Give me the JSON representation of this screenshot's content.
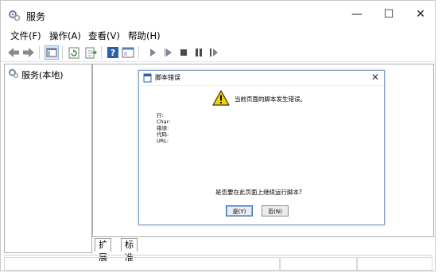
{
  "window": {
    "title": "服务",
    "minimize": "—",
    "maximize": "☐",
    "close": "✕"
  },
  "menu": [
    "文件(F)",
    "操作(A)",
    "查看(V)",
    "帮助(H)"
  ],
  "toolbar_icons": [
    "back-arrow",
    "forward-arrow",
    "console-tree",
    "refresh",
    "export-list",
    "help",
    "properties",
    "start",
    "start-alt",
    "stop",
    "pause",
    "restart"
  ],
  "tree": {
    "root": "服务(本地)"
  },
  "tabs": [
    "扩展",
    "标准"
  ],
  "dialog": {
    "title": "脚本错误",
    "close": "✕",
    "message": "当前页面的脚本发生错误。",
    "fields": [
      "行:",
      "Char:",
      "错误:",
      "代码:",
      "URL:"
    ],
    "question": "是否要在此页面上继续运行脚本?",
    "yes": "是(Y)",
    "no": "否(N)"
  },
  "colors": {
    "accent": "#3b6fb6",
    "warning_fill": "#f5d000",
    "play": "#2a7ab8"
  }
}
